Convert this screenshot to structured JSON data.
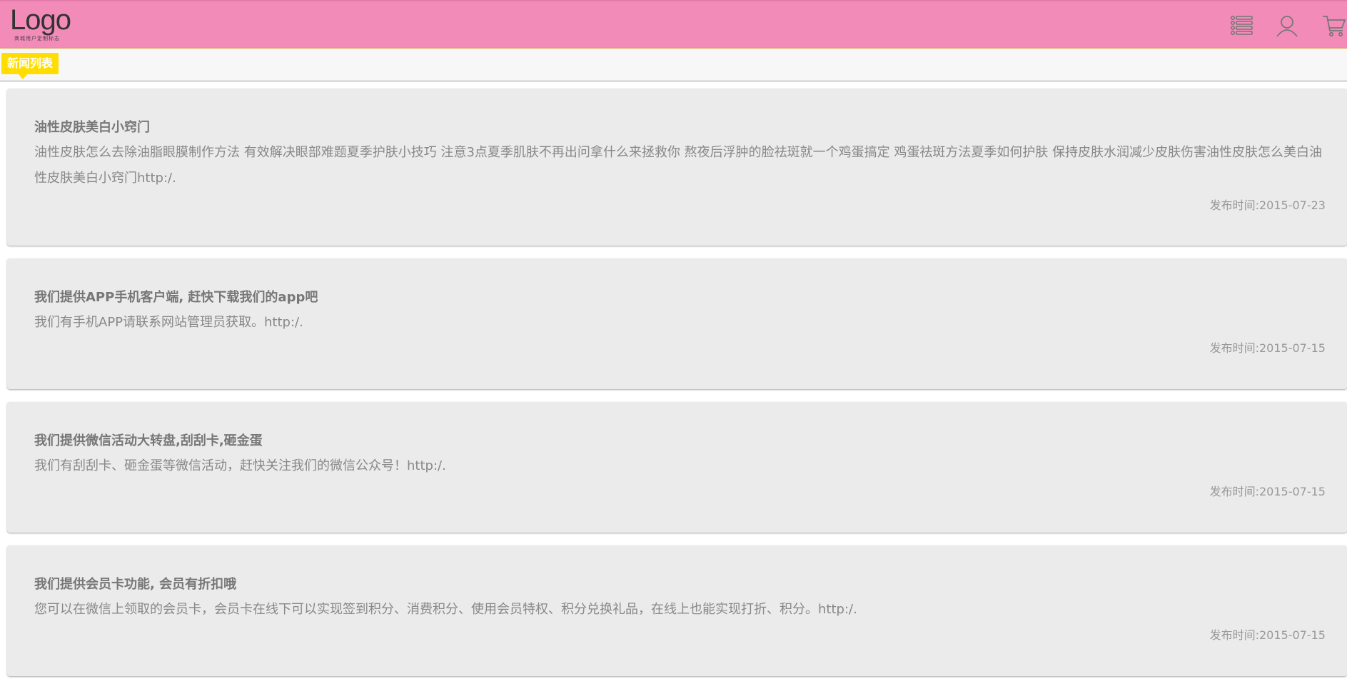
{
  "header": {
    "logo_text": "Logo",
    "logo_sub": "商城用户定制标志",
    "icons": [
      "menu-list-icon",
      "user-icon",
      "cart-icon"
    ],
    "colors": {
      "bar": "#f38bb9",
      "tag": "#ffdd00"
    }
  },
  "subbar": {
    "tab_label": "新闻列表"
  },
  "news": [
    {
      "title": "油性皮肤美白小窍门",
      "desc": "油性皮肤怎么去除油脂眼膜制作方法 有效解决眼部难题夏季护肤小技巧 注意3点夏季肌肤不再出问拿什么来拯救你 熬夜后浮肿的脸祛斑就一个鸡蛋搞定 鸡蛋祛斑方法夏季如何护肤 保持皮肤水润减少皮肤伤害油性皮肤怎么美白油性皮肤美白小窍门http:/.",
      "date": "发布时间:2015-07-23"
    },
    {
      "title": "我们提供APP手机客户端, 赶快下载我们的app吧",
      "desc": "我们有手机APP请联系网站管理员获取。http:/.",
      "date": "发布时间:2015-07-15"
    },
    {
      "title": "我们提供微信活动大转盘,刮刮卡,砸金蛋",
      "desc": "我们有刮刮卡、砸金蛋等微信活动，赶快关注我们的微信公众号！http:/.",
      "date": "发布时间:2015-07-15"
    },
    {
      "title": "我们提供会员卡功能, 会员有折扣哦",
      "desc": "您可以在微信上领取的会员卡，会员卡在线下可以实现签到积分、消费积分、使用会员特权、积分兑换礼品，在线上也能实现打折、积分。http:/.",
      "date": "发布时间:2015-07-15"
    }
  ]
}
